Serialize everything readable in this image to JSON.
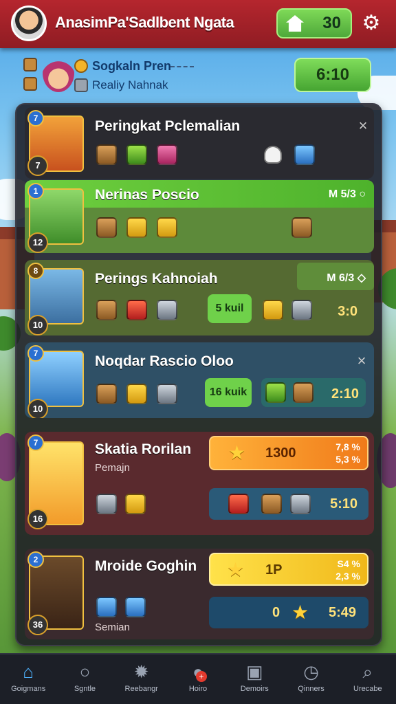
{
  "header": {
    "title": "AnasimPa'Sadlbent Ngata",
    "coins": "30",
    "icons": {
      "avatar": "player-avatar",
      "home": "house-icon",
      "settings": "gear-icon"
    }
  },
  "profile": {
    "name": "Sogkaln Pren",
    "subtitle": "Realiy Nahnak",
    "timer": "6:10"
  },
  "rows": [
    {
      "rank": "7",
      "level": "7",
      "name": "Peringkat Pclemalian",
      "tag": "",
      "close": "×"
    },
    {
      "rank": "1",
      "level": "12",
      "name": "Nerinas Poscio",
      "tag": "M 5/3 ○"
    },
    {
      "rank": "8",
      "level": "10",
      "name": "Perings Kahnoiah",
      "tag": "M 6/3 ◇",
      "pill": "5 kuil",
      "score": "3:0"
    },
    {
      "rank": "7",
      "level": "10",
      "name": "Noqdar Rascio Oloo",
      "close": "×",
      "pill": "16 kuik",
      "score": "2:10"
    },
    {
      "rank": "7",
      "level": "16",
      "name": "Skatia Rorilan",
      "sub": "Pemajn",
      "bar_value": "1300",
      "bar_pct1": "7,8 %",
      "bar_pct2": "5,3 %",
      "score": "5:10"
    },
    {
      "rank": "2",
      "level": "36",
      "name": "Mroide Goghin",
      "sub": "Semian",
      "bar_value": "1P",
      "bar_pct1": "S4 %",
      "bar_pct2": "2,3 %",
      "bottom_left": "0",
      "score": "5:49"
    }
  ],
  "nav": [
    {
      "label": "Goigmans",
      "icon": "home-icon"
    },
    {
      "label": "Sgntle",
      "icon": "search-icon"
    },
    {
      "label": "Reebangr",
      "icon": "burst-icon"
    },
    {
      "label": "Hoiro",
      "icon": "chat-icon"
    },
    {
      "label": "Demoirs",
      "icon": "tv-icon"
    },
    {
      "label": "Qinners",
      "icon": "clock-icon"
    },
    {
      "label": "Urecabe",
      "icon": "magnifier-icon"
    }
  ],
  "colors": {
    "header": "#b5262e",
    "accent_green": "#4ea83a",
    "panel": "#1e1e26",
    "nav": "#1c1f27",
    "active": "#4fb3ff"
  }
}
